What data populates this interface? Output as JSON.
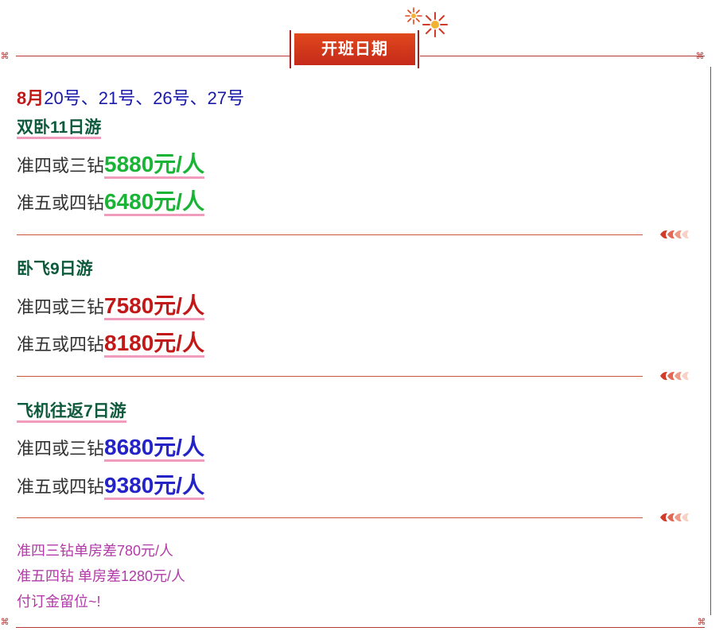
{
  "header": {
    "title": "开班日期",
    "accent_color": "#c52a1a"
  },
  "schedule": {
    "month": "8月",
    "dates": "20号、21号、26号、27号"
  },
  "trips": [
    {
      "name": "双卧11日游",
      "prices": [
        {
          "label": "准四或三钻",
          "price": "5880元/人"
        },
        {
          "label": "准五或四钻",
          "price": "6480元/人"
        }
      ],
      "price_color": "#19b436"
    },
    {
      "name": "卧飞9日游",
      "prices": [
        {
          "label": "准四或三钻",
          "price": "7580元/人"
        },
        {
          "label": "准五或四钻",
          "price": "8180元/人"
        }
      ],
      "price_color": "#c21818"
    },
    {
      "name": "飞机往返7日游",
      "prices": [
        {
          "label": "准四或三钻",
          "price": "8680元/人"
        },
        {
          "label": "准五或四钻",
          "price": "9380元/人"
        }
      ],
      "price_color": "#2323c8"
    }
  ],
  "notes": [
    "准四三钻单房差780元/人",
    "准五四钻 单房差1280元/人",
    "付订金留位~!"
  ],
  "icons": {
    "firework": "firework-icon",
    "wheat": "wheat-ornament-icon",
    "corner": "corner-ornament-icon"
  }
}
